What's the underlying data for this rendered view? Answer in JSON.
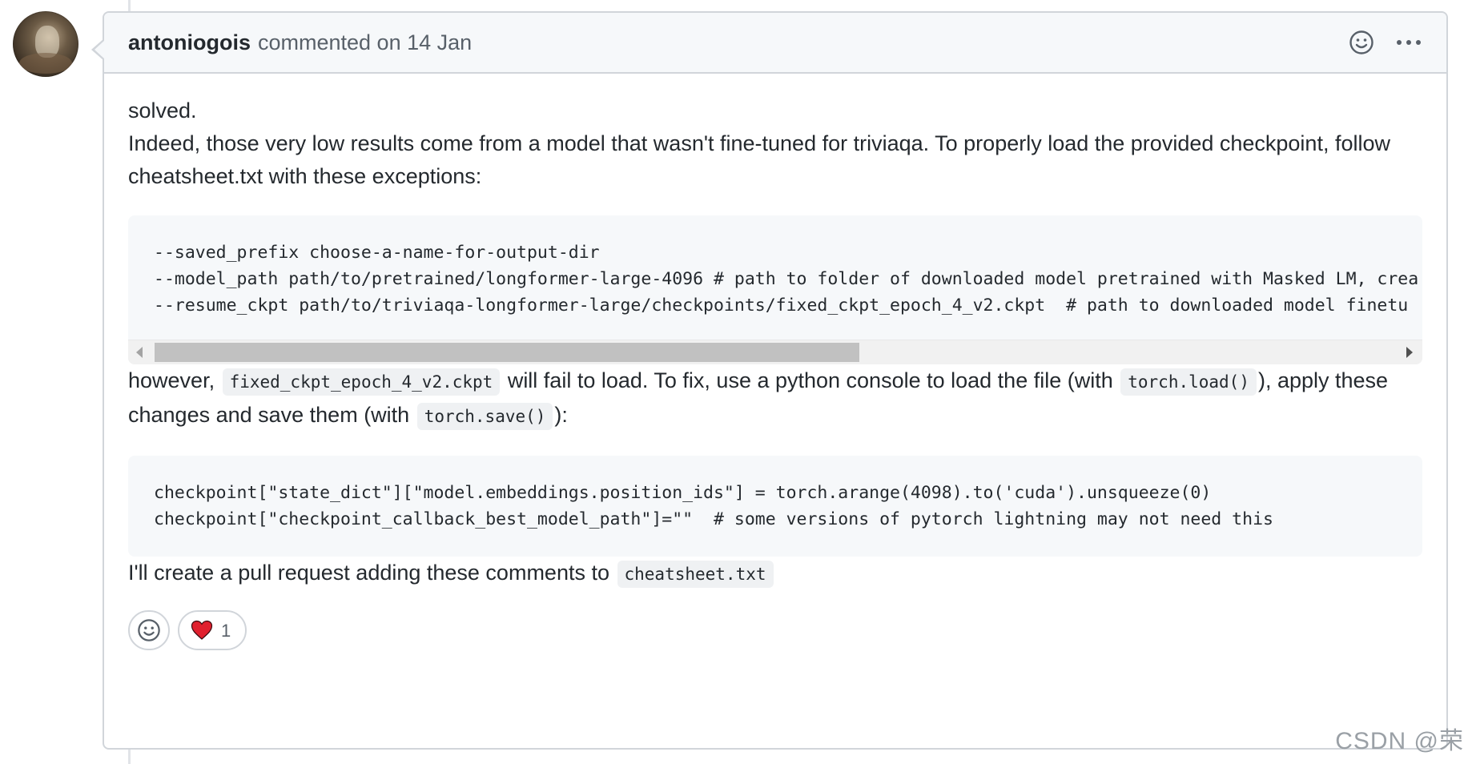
{
  "comment": {
    "author": "antoniogois",
    "action_text": "commented on 14 Jan",
    "icons": {
      "emoji": "smiley-icon",
      "more": "kebab-horizontal-icon"
    },
    "body": {
      "line1": "solved.",
      "line2": "Indeed, those very low results come from a model that wasn't fine-tuned for triviaqa. To properly load the provided checkpoint, follow cheatsheet.txt with these exceptions:",
      "code_block_1": "--saved_prefix choose-a-name-for-output-dir\n--model_path path/to/pretrained/longformer-large-4096 # path to folder of downloaded model pretrained with Masked LM, crea\n--resume_ckpt path/to/triviaqa-longformer-large/checkpoints/fixed_ckpt_epoch_4_v2.ckpt  # path to downloaded model finetu",
      "para2": {
        "t1": "however, ",
        "c1": "fixed_ckpt_epoch_4_v2.ckpt",
        "t2": " will fail to load. To fix, use a python console to load the file (with ",
        "c2": "torch.load()",
        "t3": "), apply these changes and save them (with ",
        "c3": "torch.save()",
        "t4": "):"
      },
      "code_block_2": "checkpoint[\"state_dict\"][\"model.embeddings.position_ids\"] = torch.arange(4098).to('cuda').unsqueeze(0)\ncheckpoint[\"checkpoint_callback_best_model_path\"]=\"\"  # some versions of pytorch lightning may not need this",
      "para3": {
        "t1": "I'll create a pull request adding these comments to ",
        "c1": "cheatsheet.txt"
      }
    },
    "reactions": [
      {
        "icon": "smiley-icon",
        "count": ""
      },
      {
        "icon": "heart-icon",
        "count": "1"
      }
    ]
  },
  "watermark": "CSDN @荣",
  "colors": {
    "border": "#d1d5da",
    "header_bg": "#f6f8fa",
    "code_bg": "#f6f8fa",
    "heart": "#e0202e"
  }
}
